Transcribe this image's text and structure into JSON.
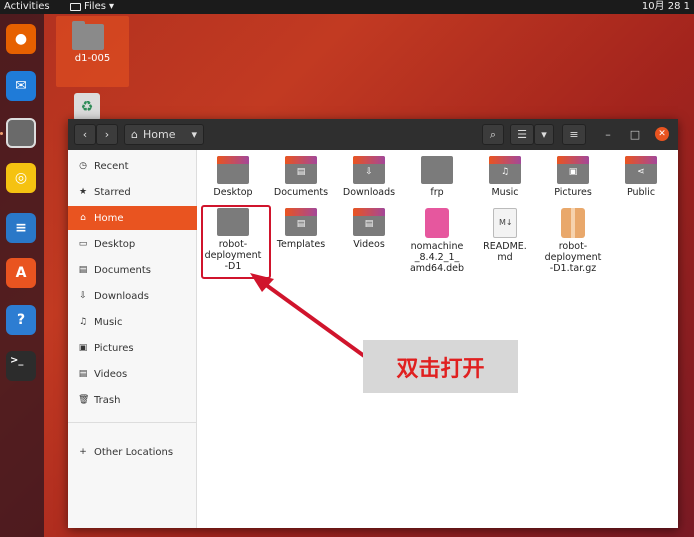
{
  "topbar": {
    "activities": "Activities",
    "app_menu": "Files",
    "clock": "10月 28 1"
  },
  "desktop": {
    "folder_label": "d1-005"
  },
  "dock": {
    "items": [
      {
        "name": "firefox-icon",
        "glyph": "●",
        "color": "#e66000"
      },
      {
        "name": "thunderbird-icon",
        "glyph": "✉",
        "color": "#1f7bd8"
      },
      {
        "name": "files-icon",
        "glyph": "",
        "color": "#6a6a6a"
      },
      {
        "name": "rhythmbox-icon",
        "glyph": "◎",
        "color": "#f5c211"
      },
      {
        "name": "writer-icon",
        "glyph": "≡",
        "color": "#2a78c8"
      },
      {
        "name": "software-icon",
        "glyph": "A",
        "color": "#e95420"
      },
      {
        "name": "help-icon",
        "glyph": "?",
        "color": "#2d7dd2"
      },
      {
        "name": "terminal-icon",
        "glyph": ">_",
        "color": "#2c2c2c"
      }
    ]
  },
  "window": {
    "location": "Home",
    "sidebar": [
      {
        "label": "Recent",
        "icon": "clock-icon",
        "glyph": "◷"
      },
      {
        "label": "Starred",
        "icon": "star-icon",
        "glyph": "★"
      },
      {
        "label": "Home",
        "icon": "home-icon",
        "glyph": "⌂",
        "active": true
      },
      {
        "label": "Desktop",
        "icon": "desktop-icon",
        "glyph": "▭"
      },
      {
        "label": "Documents",
        "icon": "documents-icon",
        "glyph": "▤"
      },
      {
        "label": "Downloads",
        "icon": "download-icon",
        "glyph": "⇩"
      },
      {
        "label": "Music",
        "icon": "music-icon",
        "glyph": "♫"
      },
      {
        "label": "Pictures",
        "icon": "pictures-icon",
        "glyph": "▣"
      },
      {
        "label": "Videos",
        "icon": "videos-icon",
        "glyph": "▤"
      },
      {
        "label": "Trash",
        "icon": "trash-icon",
        "glyph": "🗑"
      }
    ],
    "other_locations": "Other Locations",
    "files": [
      {
        "label": "Desktop",
        "kind": "folder-top"
      },
      {
        "label": "Documents",
        "kind": "folder",
        "glyph": "▤"
      },
      {
        "label": "Downloads",
        "kind": "folder",
        "glyph": "⇩"
      },
      {
        "label": "frp",
        "kind": "folder"
      },
      {
        "label": "Music",
        "kind": "folder",
        "glyph": "♫"
      },
      {
        "label": "Pictures",
        "kind": "folder",
        "glyph": "▣"
      },
      {
        "label": "Public",
        "kind": "folder",
        "glyph": "⋖"
      },
      {
        "label": "robot-deployment-D1",
        "lines": [
          "robot-",
          "deployment",
          "-D1"
        ],
        "kind": "folder"
      },
      {
        "label": "Templates",
        "kind": "folder",
        "glyph": "▤"
      },
      {
        "label": "Videos",
        "kind": "folder",
        "glyph": "▤"
      },
      {
        "label": "nomachine_8.4.2_1_amd64.deb",
        "lines": [
          "nomachine",
          "_8.4.2_1_",
          "amd64.deb"
        ],
        "kind": "deb"
      },
      {
        "label": "README.md",
        "lines": [
          "README.",
          "md"
        ],
        "kind": "md",
        "glyph": "M↓"
      },
      {
        "label": "robot-deployment-D1.tar.gz",
        "lines": [
          "robot-",
          "deployment",
          "-D1.tar.gz"
        ],
        "kind": "tgz"
      }
    ]
  },
  "annotation": {
    "text": "双击打开",
    "color": "#e02020"
  }
}
